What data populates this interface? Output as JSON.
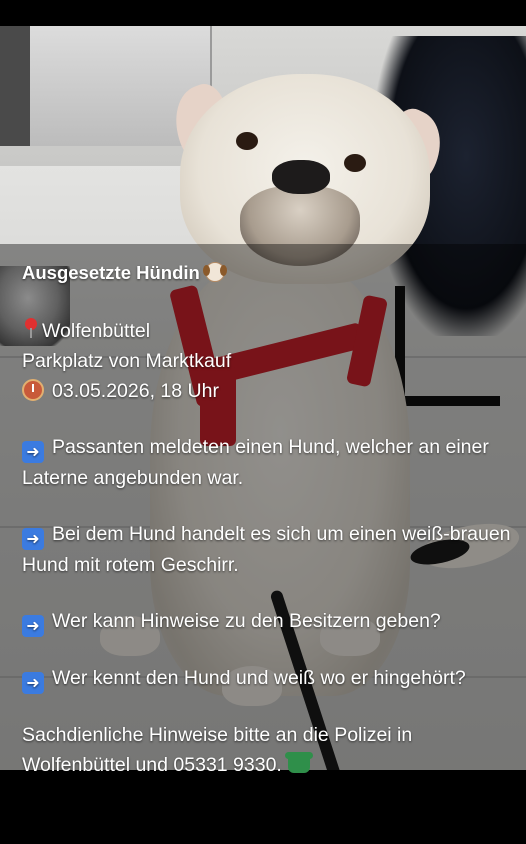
{
  "post": {
    "title": "Ausgesetzte Hündin",
    "location_line1": "Wolfenbüttel",
    "location_line2": "Parkplatz von Marktkauf",
    "datetime": "03.05.2026, 18 Uhr",
    "items": [
      "Passanten meldeten einen Hund, welcher an einer Laterne angebunden war.",
      "Bei dem Hund handelt es sich um einen weiß-brauen Hund mit rotem Geschirr.",
      "Wer kann Hinweise zu den Besitzern geben?",
      "Wer kennt den Hund und weiß wo er hingehört?"
    ],
    "footer": "Sachdienliche Hinweise bitte an die Polizei in Wolfenbüttel und 05331 9330."
  },
  "icons": {
    "title_emoji": "dog-face-icon",
    "location_emoji": "pin-icon",
    "time_emoji": "alarm-clock-icon",
    "bullet_emoji": "right-arrow-icon",
    "footer_emoji": "telephone-icon"
  },
  "colors": {
    "harness": "#c8202a",
    "arrow_badge": "#3b7be0",
    "text": "#ffffff"
  }
}
